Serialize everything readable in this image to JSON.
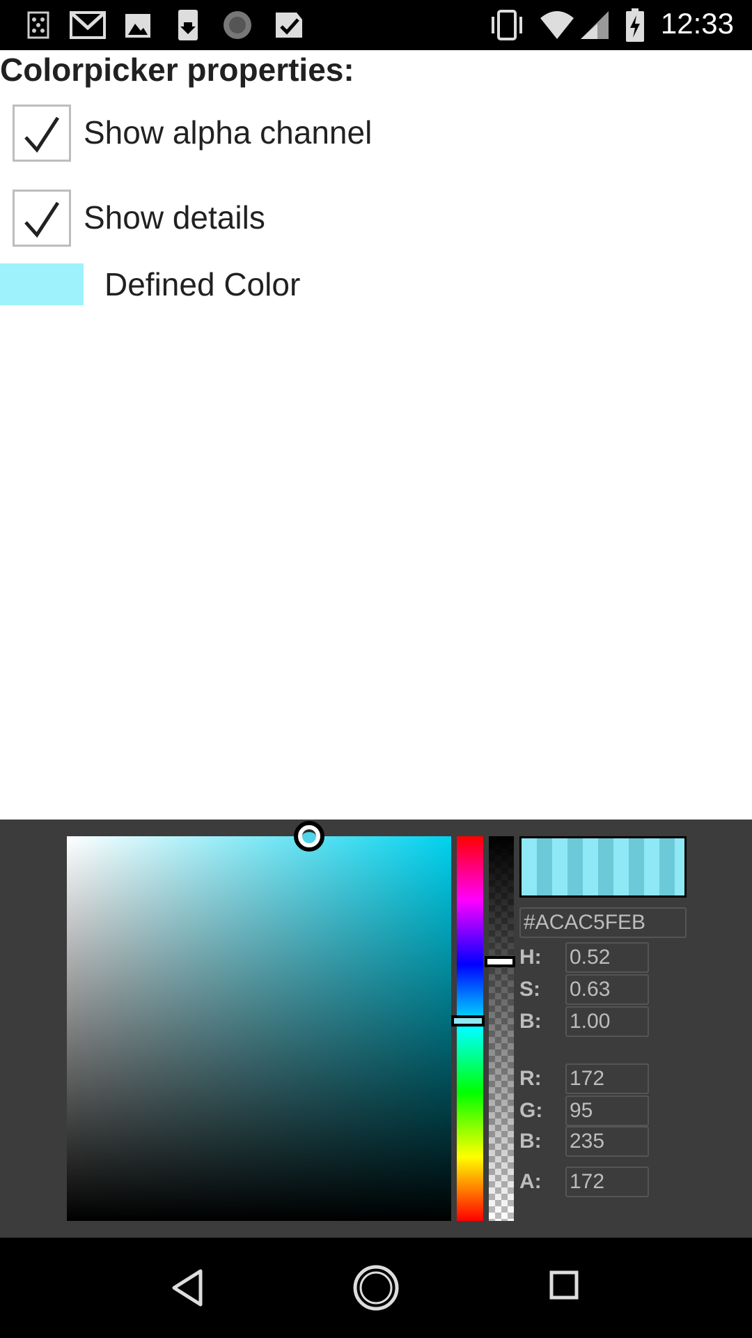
{
  "status_bar": {
    "time": "12:33",
    "left_icons": [
      "sim-icon",
      "gmail-icon",
      "image-icon",
      "download-icon",
      "sync-icon",
      "check-icon"
    ],
    "right_icons": [
      "vibrate-icon",
      "wifi-icon",
      "signal-icon",
      "battery-charging-icon"
    ]
  },
  "properties": {
    "title": "Colorpicker properties:",
    "show_alpha": {
      "label": "Show alpha channel",
      "checked": true
    },
    "show_details": {
      "label": "Show details",
      "checked": true
    },
    "defined_color": {
      "label": "Defined Color",
      "color": "#9ef2fb"
    }
  },
  "picker": {
    "hex": "#ACAC5FEB",
    "hsb": [
      {
        "label": "H:",
        "value": "0.52"
      },
      {
        "label": "S:",
        "value": "0.63"
      },
      {
        "label": "B:",
        "value": "1.00"
      }
    ],
    "rgba": [
      {
        "label": "R:",
        "value": "172"
      },
      {
        "label": "G:",
        "value": "95"
      },
      {
        "label": "B:",
        "value": "235"
      },
      {
        "label": "A:",
        "value": "172"
      }
    ],
    "saturation": 0.63,
    "brightness": 1.0,
    "hue": 0.52,
    "alpha_level": 0.674,
    "colors": {
      "panel_bg": "#3c3c3c",
      "hue_base": "#00d2ee",
      "preview": "#8fe8f5"
    }
  },
  "nav_bar": {
    "icons": [
      "back-icon",
      "home-icon",
      "recents-icon"
    ]
  }
}
